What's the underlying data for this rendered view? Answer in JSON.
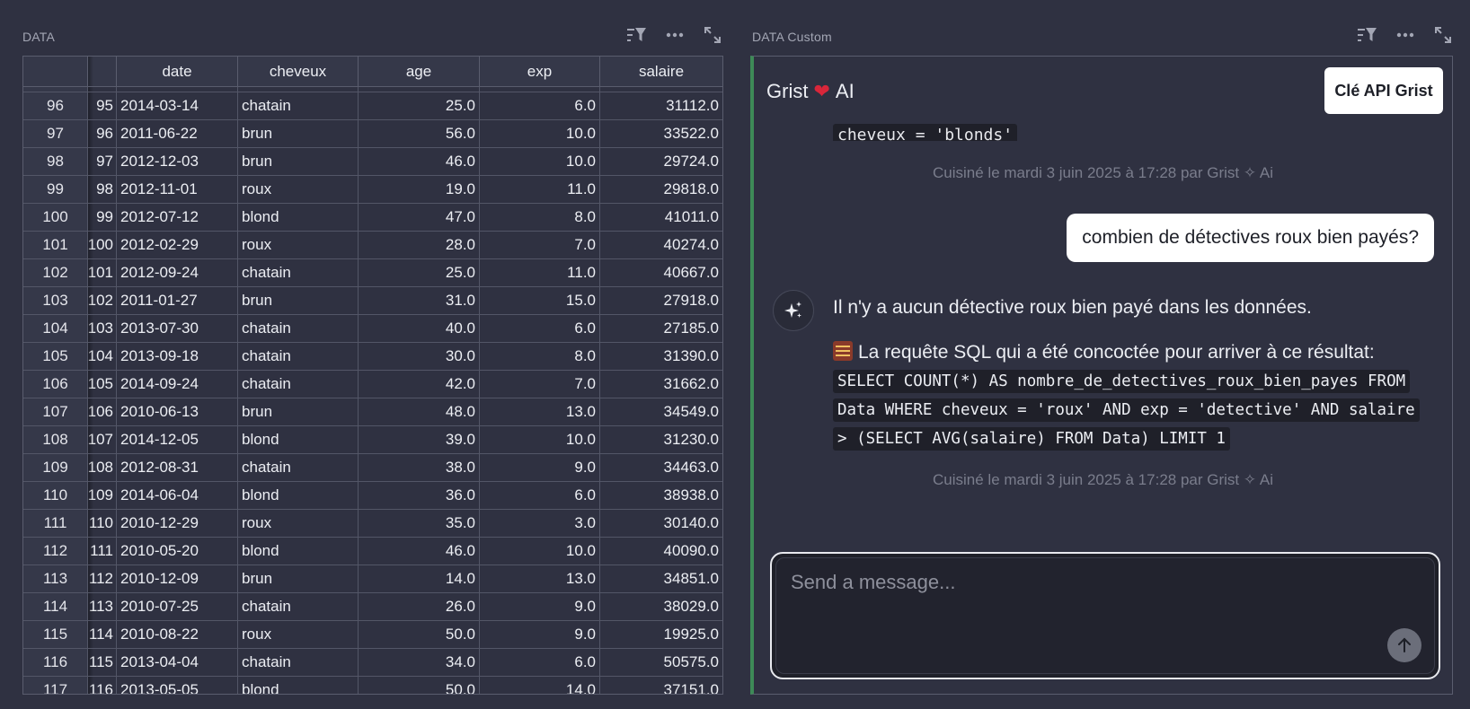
{
  "left_panel": {
    "title": "DATA",
    "columns": {
      "date": "date",
      "cheveux": "cheveux",
      "age": "age",
      "exp": "exp",
      "salaire": "salaire"
    },
    "rows": [
      {
        "rn": "96",
        "id": "95",
        "date": "2014-03-14",
        "cheveux": "chatain",
        "age": "25.0",
        "exp": "6.0",
        "salaire": "31112.0"
      },
      {
        "rn": "97",
        "id": "96",
        "date": "2011-06-22",
        "cheveux": "brun",
        "age": "56.0",
        "exp": "10.0",
        "salaire": "33522.0"
      },
      {
        "rn": "98",
        "id": "97",
        "date": "2012-12-03",
        "cheveux": "brun",
        "age": "46.0",
        "exp": "10.0",
        "salaire": "29724.0"
      },
      {
        "rn": "99",
        "id": "98",
        "date": "2012-11-01",
        "cheveux": "roux",
        "age": "19.0",
        "exp": "11.0",
        "salaire": "29818.0"
      },
      {
        "rn": "100",
        "id": "99",
        "date": "2012-07-12",
        "cheveux": "blond",
        "age": "47.0",
        "exp": "8.0",
        "salaire": "41011.0"
      },
      {
        "rn": "101",
        "id": "100",
        "date": "2012-02-29",
        "cheveux": "roux",
        "age": "28.0",
        "exp": "7.0",
        "salaire": "40274.0"
      },
      {
        "rn": "102",
        "id": "101",
        "date": "2012-09-24",
        "cheveux": "chatain",
        "age": "25.0",
        "exp": "11.0",
        "salaire": "40667.0"
      },
      {
        "rn": "103",
        "id": "102",
        "date": "2011-01-27",
        "cheveux": "brun",
        "age": "31.0",
        "exp": "15.0",
        "salaire": "27918.0"
      },
      {
        "rn": "104",
        "id": "103",
        "date": "2013-07-30",
        "cheveux": "chatain",
        "age": "40.0",
        "exp": "6.0",
        "salaire": "27185.0"
      },
      {
        "rn": "105",
        "id": "104",
        "date": "2013-09-18",
        "cheveux": "chatain",
        "age": "30.0",
        "exp": "8.0",
        "salaire": "31390.0"
      },
      {
        "rn": "106",
        "id": "105",
        "date": "2014-09-24",
        "cheveux": "chatain",
        "age": "42.0",
        "exp": "7.0",
        "salaire": "31662.0"
      },
      {
        "rn": "107",
        "id": "106",
        "date": "2010-06-13",
        "cheveux": "brun",
        "age": "48.0",
        "exp": "13.0",
        "salaire": "34549.0"
      },
      {
        "rn": "108",
        "id": "107",
        "date": "2014-12-05",
        "cheveux": "blond",
        "age": "39.0",
        "exp": "10.0",
        "salaire": "31230.0"
      },
      {
        "rn": "109",
        "id": "108",
        "date": "2012-08-31",
        "cheveux": "chatain",
        "age": "38.0",
        "exp": "9.0",
        "salaire": "34463.0"
      },
      {
        "rn": "110",
        "id": "109",
        "date": "2014-06-04",
        "cheveux": "blond",
        "age": "36.0",
        "exp": "6.0",
        "salaire": "38938.0"
      },
      {
        "rn": "111",
        "id": "110",
        "date": "2010-12-29",
        "cheveux": "roux",
        "age": "35.0",
        "exp": "3.0",
        "salaire": "30140.0"
      },
      {
        "rn": "112",
        "id": "111",
        "date": "2010-05-20",
        "cheveux": "blond",
        "age": "46.0",
        "exp": "10.0",
        "salaire": "40090.0"
      },
      {
        "rn": "113",
        "id": "112",
        "date": "2010-12-09",
        "cheveux": "brun",
        "age": "14.0",
        "exp": "13.0",
        "salaire": "34851.0"
      },
      {
        "rn": "114",
        "id": "113",
        "date": "2010-07-25",
        "cheveux": "chatain",
        "age": "26.0",
        "exp": "9.0",
        "salaire": "38029.0"
      },
      {
        "rn": "115",
        "id": "114",
        "date": "2010-08-22",
        "cheveux": "roux",
        "age": "50.0",
        "exp": "9.0",
        "salaire": "19925.0"
      },
      {
        "rn": "116",
        "id": "115",
        "date": "2013-04-04",
        "cheveux": "chatain",
        "age": "34.0",
        "exp": "6.0",
        "salaire": "50575.0"
      },
      {
        "rn": "117",
        "id": "116",
        "date": "2013-05-05",
        "cheveux": "blond",
        "age": "50.0",
        "exp": "14.0",
        "salaire": "37151.0"
      }
    ]
  },
  "right_panel": {
    "title": "DATA Custom",
    "chat_title": "Grist",
    "chat_title_suffix": "AI",
    "heart_glyph": "❤",
    "api_button": "Clé API Grist",
    "prev_code": "cheveux = 'blonds'",
    "timestamp_1": "Cuisiné le mardi 3 juin 2025 à 17:28 par Grist ✧ Ai",
    "user_message": "combien de détectives roux bien payés?",
    "ai_answer": "Il n'y a aucun détective roux bien payé dans les données.",
    "ai_sql_intro": "La requête SQL qui a été concoctée pour arriver à ce résultat:",
    "ai_sql": "SELECT COUNT(*) AS nombre_de_detectives_roux_bien_payes FROM Data WHERE cheveux = 'roux' AND exp = 'detective' AND salaire > (SELECT AVG(salaire) FROM Data) LIMIT 1",
    "timestamp_2": "Cuisiné le mardi 3 juin 2025 à 17:28 par Grist ✧ Ai",
    "composer_placeholder": "Send a message..."
  },
  "icons": {
    "sort_filter": "sort-filter-icon",
    "more": "more-dots-icon",
    "expand": "expand-icon",
    "sparkle": "sparkle-icon",
    "send": "arrow-up-icon",
    "abacus": "abacus-icon"
  },
  "colors": {
    "background": "#2f3141",
    "accent_green": "#3e8a57",
    "heart": "#d9263a"
  }
}
